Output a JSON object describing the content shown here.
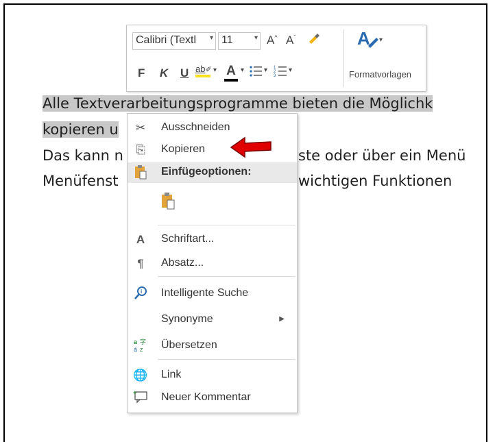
{
  "document": {
    "line1": "Alle Textverarbeitungsprogramme bieten die Möglichk",
    "line2": "kopieren u",
    "line3_left": "Das kann n",
    "line3_right": "ste oder über ein Menü",
    "line4_left": "Menüfenst",
    "line4_right": "wichtigen Funktionen"
  },
  "mini_toolbar": {
    "font_name": "Calibri (Textl",
    "font_size": "11",
    "grow_font": "A",
    "shrink_font": "A",
    "bold": "F",
    "italic": "K",
    "underline": "U",
    "highlight": "ab",
    "font_color": "A",
    "styles_label": "Formatvorlagen",
    "highlight_color": "#f7e21b",
    "font_color_value": "#000000"
  },
  "context_menu": {
    "cut": "Ausschneiden",
    "copy": "Kopieren",
    "paste_options_header": "Einfügeoptionen:",
    "font": "Schriftart...",
    "paragraph": "Absatz...",
    "smart_lookup": "Intelligente Suche",
    "synonyms": "Synonyme",
    "translate": "Übersetzen",
    "link": "Link",
    "new_comment": "Neuer Kommentar"
  },
  "colors": {
    "selection": "#c8c8c8",
    "header_bg": "#e9e9e9",
    "arrow_red": "#e00000",
    "icon_blue": "#2b6cb0"
  }
}
